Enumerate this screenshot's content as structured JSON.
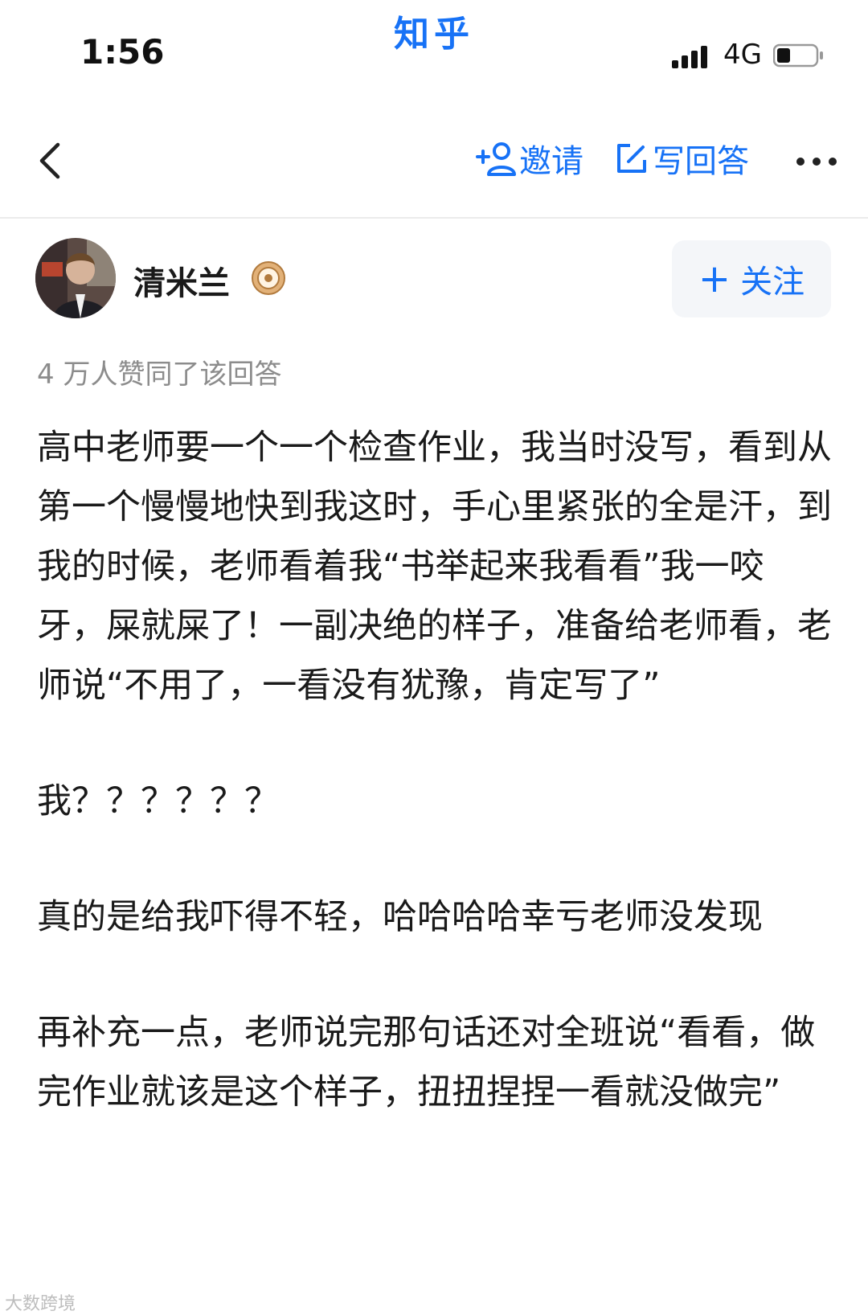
{
  "app_title": "知乎",
  "status": {
    "time": "1:56",
    "network": "4G",
    "battery_level": 0.35
  },
  "nav": {
    "invite_label": "邀请",
    "write_answer_label": "写回答"
  },
  "author": {
    "name": "清米兰",
    "follow_label": "关注"
  },
  "likes_text": "4 万人赞同了该回答",
  "paragraphs": [
    "高中老师要一个一个检查作业，我当时没写，看到从第一个慢慢地快到我这时，手心里紧张的全是汗，到我的时候，老师看着我“书举起来我看看”我一咬牙，屎就屎了！一副决绝的样子，准备给老师看，老师说“不用了，一看没有犹豫，肯定写了”",
    "我？？？？？？",
    "真的是给我吓得不轻，哈哈哈哈幸亏老师没发现",
    "再补充一点，老师说完那句话还对全班说“看看，做完作业就该是这个样子，扭扭捏捏一看就没做完”"
  ],
  "corner_mark": "大数跨境",
  "colors": {
    "accent": "#1772f6",
    "text": "#1a1a1a",
    "muted": "#8c8c8c",
    "follow_bg": "#f4f6f9"
  }
}
